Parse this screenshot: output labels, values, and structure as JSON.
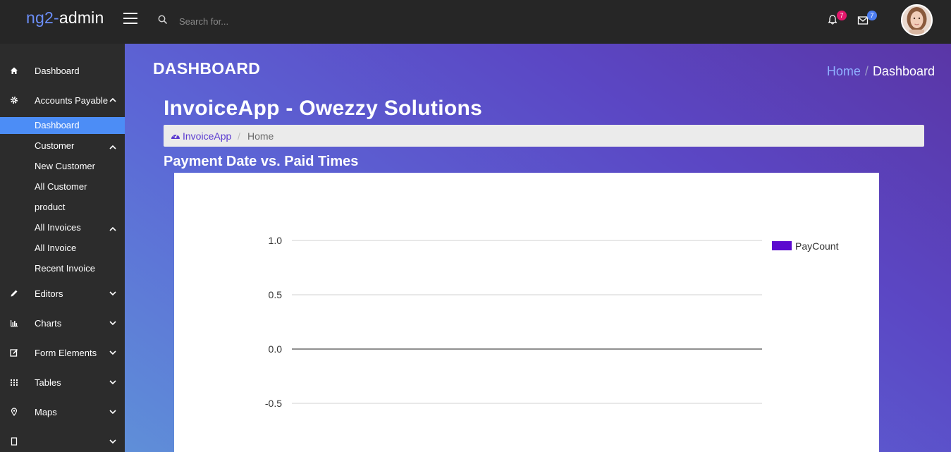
{
  "brand": {
    "part1": "ng2-",
    "part2": "admin"
  },
  "search": {
    "placeholder": "Search for..."
  },
  "notifications": {
    "bell_count": "7",
    "mail_count": "7"
  },
  "sidebar": {
    "items": [
      {
        "label": "Dashboard",
        "icon": "home-icon"
      },
      {
        "label": "Accounts Payable",
        "icon": "gear-icon",
        "expanded": true
      },
      {
        "label": "Editors",
        "icon": "pencil-icon"
      },
      {
        "label": "Charts",
        "icon": "bar-chart-icon"
      },
      {
        "label": "Form Elements",
        "icon": "edit-box-icon"
      },
      {
        "label": "Tables",
        "icon": "grid-icon"
      },
      {
        "label": "Maps",
        "icon": "map-pin-icon"
      }
    ],
    "subitems": [
      {
        "label": "Dashboard",
        "active": true
      },
      {
        "label": "Customer",
        "expanded": true
      },
      {
        "label": "New Customer"
      },
      {
        "label": "All Customer"
      },
      {
        "label": "product"
      },
      {
        "label": "All Invoices",
        "expanded": true
      },
      {
        "label": "All Invoice"
      },
      {
        "label": "Recent Invoice"
      }
    ],
    "active_color": "#4c8df6"
  },
  "header": {
    "title": "DASHBOARD",
    "breadcrumb": {
      "home": "Home",
      "current": "Dashboard"
    }
  },
  "main": {
    "app_title": "InvoiceApp - Owezzy Solutions",
    "breadcrumb": {
      "root": "InvoiceApp",
      "separator": "/",
      "current": "Home"
    },
    "chart_heading": "Payment Date vs. Paid Times"
  },
  "chart_data": {
    "type": "bar",
    "title": "Payment Date vs. Paid Times",
    "categories": [],
    "series": [
      {
        "name": "PayCount",
        "values": [],
        "color": "#5b0acf"
      }
    ],
    "yticks": [
      "1.0",
      "0.5",
      "0.0",
      "-0.5"
    ],
    "ylim": [
      -1,
      1
    ],
    "grid": true,
    "legend": "top-right"
  }
}
